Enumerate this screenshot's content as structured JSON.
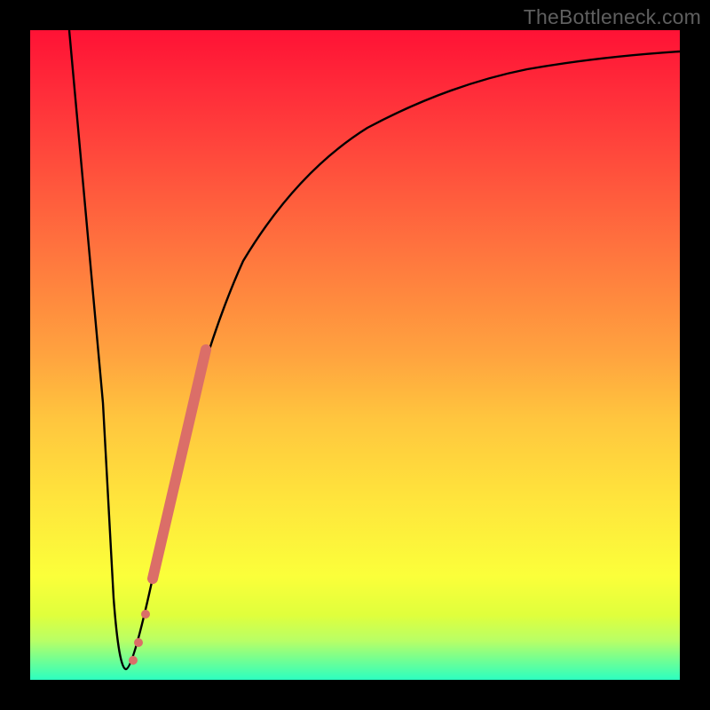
{
  "watermark": "TheBottleneck.com",
  "chart_data": {
    "type": "line",
    "title": "",
    "xlabel": "",
    "ylabel": "",
    "xlim": [
      0,
      100
    ],
    "ylim": [
      0,
      100
    ],
    "series": [
      {
        "name": "bottleneck-curve",
        "x": [
          6,
          8,
          10,
          11,
          12,
          13,
          14,
          16,
          18,
          22,
          26,
          30,
          36,
          44,
          54,
          66,
          80,
          100
        ],
        "y": [
          100,
          62,
          24,
          8,
          2,
          4,
          12,
          30,
          46,
          64,
          74,
          80,
          85,
          89,
          92,
          94,
          95,
          96
        ]
      }
    ],
    "highlight_segment": {
      "name": "bead-cluster",
      "x": [
        14,
        15,
        16.5,
        24
      ],
      "y": [
        4,
        8,
        20,
        62
      ]
    }
  },
  "colors": {
    "bead": "#db6e68",
    "curve": "#000000",
    "gradient_top": "#ff1235",
    "gradient_bottom": "#2cffc0"
  }
}
